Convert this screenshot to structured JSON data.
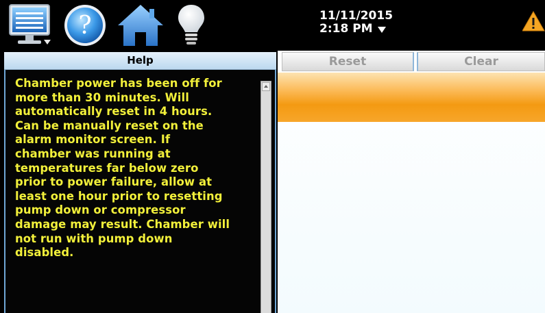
{
  "toolbar": {
    "icons": {
      "monitor": "monitor-menu-icon",
      "help": "help-icon",
      "home": "home-icon",
      "bulb": "light-bulb-icon",
      "warning": "warning-icon"
    },
    "date": "11/11/2015",
    "time": "2:18 PM"
  },
  "help_panel": {
    "title": "Help",
    "message": "Chamber power has been off for\nmore than 30 minutes. Will\nautomatically reset in 4 hours.\nCan be manually reset on the\nalarm monitor screen. If\nchamber was running at\ntemperatures far below zero\nprior to power failure, allow at\nleast one hour prior to resetting\npump down or compressor\ndamage may result. Chamber will\nnot run with pump down\ndisabled."
  },
  "alarm_panel": {
    "reset_label": "Reset",
    "clear_label": "Clear"
  },
  "colors": {
    "help_text": "#f2f03a",
    "alarm_highlight": "#f49a12",
    "panel_accent": "#6fa7d6"
  }
}
